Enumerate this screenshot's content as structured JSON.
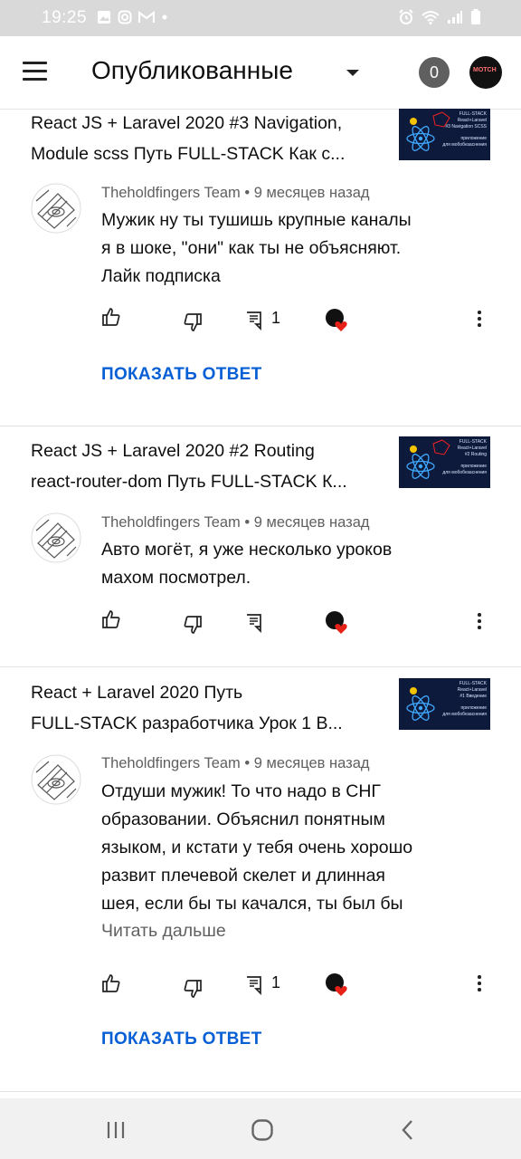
{
  "status_bar": {
    "time": "19:25"
  },
  "app_bar": {
    "title": "Опубликованные",
    "count": "0",
    "avatar_text": "MOTCH"
  },
  "items": [
    {
      "video_title": [
        "React JS + Laravel 2020 #3 Navigation,",
        "Module scss Путь FULL-STACK Как с..."
      ],
      "thumb": [
        "FULL-STACK",
        "React+Laravel",
        "#3 Navigation SCSS",
        "приложение",
        "для мобобезаснения"
      ],
      "author": "Theholdfingers Team",
      "time_ago": "9 месяцев назад",
      "comment": [
        "Мужик ну ты тушишь крупные каналы",
        "я в шоке, \"они\" как ты не объясняют.",
        "Лайк подписка"
      ],
      "reply_count": "1",
      "show_reply": "ПОКАЗАТЬ ОТВЕТ"
    },
    {
      "video_title": [
        "React JS + Laravel 2020 #2 Routing",
        "react-router-dom Путь FULL-STACK К..."
      ],
      "thumb": [
        "FULL-STACK",
        "React+Laravel",
        "#2 Routing",
        "приложение",
        "для мобобезаснения"
      ],
      "author": "Theholdfingers Team",
      "time_ago": "9 месяцев назад",
      "comment": [
        "Авто могёт, я уже несколько уроков",
        "махом посмотрел."
      ]
    },
    {
      "video_title": [
        "React + Laravel 2020 Путь",
        "FULL-STACK разработчика Урок 1 В..."
      ],
      "thumb": [
        "FULL-STACK",
        "React+Laravel",
        "#1 Введение",
        "приложение",
        "для мобобезаснения"
      ],
      "author": "Theholdfingers Team",
      "time_ago": "9 месяцев назад",
      "comment": [
        "Отдуши мужик! То что надо в СНГ",
        "образовании. Объяснил понятным",
        "языком, и кстати у тебя очень хорошо",
        "развит плечевой скелет и длинная",
        "шея, если бы ты качался, ты был бы"
      ],
      "read_more": "Читать дальше",
      "reply_count": "1",
      "show_reply": "ПОКАЗАТЬ ОТВЕТ"
    }
  ],
  "meta_separator": "•",
  "colors": {
    "link": "#065fd4",
    "heart": "#e62117",
    "meta": "#606060"
  }
}
